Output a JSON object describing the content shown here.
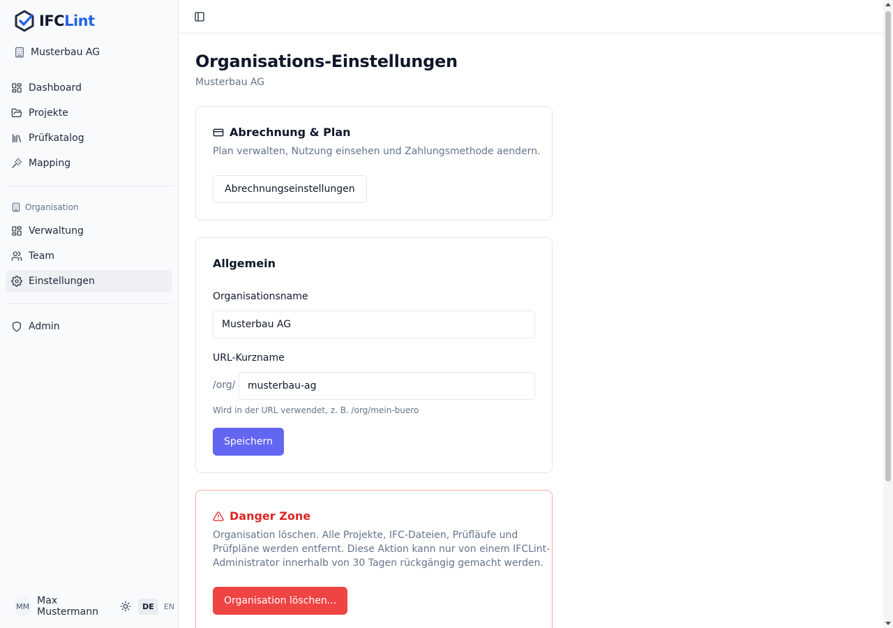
{
  "brand": {
    "name_part1": "IFC",
    "name_part2": "Lint",
    "accent": "#2563eb"
  },
  "org_switcher": {
    "label": "Musterbau AG",
    "icon": "building-icon"
  },
  "sidebar": {
    "main_items": [
      {
        "label": "Dashboard",
        "icon": "layout-grid-icon"
      },
      {
        "label": "Projekte",
        "icon": "folder-open-icon"
      },
      {
        "label": "Prüfkatalog",
        "icon": "library-icon"
      },
      {
        "label": "Mapping",
        "icon": "wand-icon"
      }
    ],
    "section_label": "Organisation",
    "org_items": [
      {
        "label": "Verwaltung",
        "icon": "layout-grid-icon"
      },
      {
        "label": "Team",
        "icon": "users-icon"
      },
      {
        "label": "Einstellungen",
        "icon": "settings-icon",
        "active": true
      }
    ],
    "admin_item": {
      "label": "Admin",
      "icon": "shield-icon"
    }
  },
  "user": {
    "initials": "MM",
    "name": "Max Mustermann",
    "theme_icon": "sun-icon",
    "languages": [
      "DE",
      "EN"
    ],
    "active_language": "DE"
  },
  "page": {
    "title": "Organisations-Einstellungen",
    "subtitle": "Musterbau AG"
  },
  "billing_card": {
    "title": "Abrechnung & Plan",
    "icon": "credit-card-icon",
    "description": "Plan verwalten, Nutzung einsehen und Zahlungsmethode aendern.",
    "button_label": "Abrechnungseinstellungen"
  },
  "general_card": {
    "title": "Allgemein",
    "name_label": "Organisationsname",
    "name_value": "Musterbau AG",
    "slug_label": "URL-Kurzname",
    "slug_prefix": "/org/",
    "slug_value": "musterbau-ag",
    "slug_hint": "Wird in der URL verwendet, z. B. /org/mein-buero",
    "save_label": "Speichern",
    "primary_color": "#6366f1"
  },
  "danger_card": {
    "title": "Danger Zone",
    "icon": "alert-triangle-icon",
    "description_lines": [
      "Organisation löschen. Alle Projekte, IFC-Dateien, Prüfläufe und",
      "Prüfpläne werden entfernt. Diese Aktion kann nur von einem IFCLint-",
      "Administrator innerhalb von 30 Tagen rückgängig gemacht werden."
    ],
    "button_label": "Organisation löschen...",
    "danger_color": "#ef4444"
  }
}
